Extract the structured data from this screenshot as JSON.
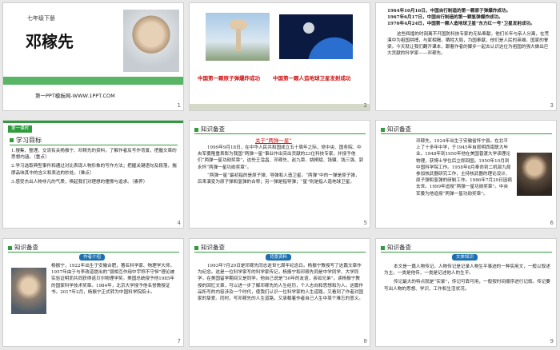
{
  "slides": [
    {
      "num": "1",
      "grade": "七年级下册",
      "title": "邓稼先",
      "footer": "第一PPT模板网-WWW.1PPT.COM"
    },
    {
      "num": "2",
      "caption1": "中国第一颗原子弹爆炸成功",
      "caption2": "中国第一颗人造地球卫星发射成功"
    },
    {
      "num": "3",
      "lines_red": [
        "1964年10月16日，中国自行制造的第一颗原子弹爆炸成功。",
        "1967年6月17日，中国自行制造的第一颗氢弹爆炸成功。",
        "1970年4月24日，中国第一颗人造地球卫星“东方红一号”卫星发射成功。"
      ],
      "para": "这些辉煌的时刻离不开国防科技专家的无私奉献。他们长年与亲人分离，在荒漠中为祖国拼搏，与家相隔，牺牲大局，为国奉献，他们是人民的英雄，国家的脊梁。今天就让我们翻开课本，跟着作者的脚步一起去认识这位为祖国的强大做出巨大贡献的科学家——邓稼先。"
    },
    {
      "num": "4",
      "tab": "第一课时",
      "section": "学习目标",
      "items": [
        "1.搜集、整理、交流有关杨振宁、邓稼先的资料，了解作者及写作背景，把握文章的思想内涵。（重点）",
        "2.学习选取典型事件和通过对比表现人物形象的写作方法；把握关键语句及段落，揣摩品味其中的含义和表达的妙处。（难点）",
        "3.感受杰出人物非凡的气质，唤起我们对理想的憧憬与追求。（素养）"
      ]
    },
    {
      "num": "5",
      "section": "知识备查",
      "title": "关于“两弹一星”",
      "para": "1999年9月18日，在中华人民共和国成立五十周年之际，党中央、国务院、中央军委隆重表彰为我国“两弹一星”事业作出突出贡献的23位科技专家，并授予他们“两弹一星功勋奖章”，这些王淦昌、邓稼先、赵九章、姚桐斌、钱骥、钱三强、郭永怀“两弹一星功勋奖章”。",
      "note": "“两弹一星”最初指的是原子弹、导弹和人造卫星。“两弹”中的一弹是原子弹，后来演变为原子弹和氢弹的合称；另一弹是指导弹；“星”则是指人造地球卫星。"
    },
    {
      "num": "6",
      "section": "知识备查",
      "para": "邓稼先，1924年出生于安徽省怀宁县。在北平上了十多年中学，于1945年自昆明西南联大毕业。1948年到1950年他在美国普渡大学读理论物理，获博士学位后立即回国。1950年10月到中国科学院工作。1958年8月奉命到二机部九局参加核武器研究工作，主持核武器的理论设计、原子弹和氢弹的研制工作。1986年7月29日因病去世。1999年追授“两弹一星功勋奖章”。中央军委为他追授“两弹一星功勋奖章”。"
    },
    {
      "num": "7",
      "section": "知识备查",
      "label": "作者介绍",
      "para": "杨振宁，1922年出生于安徽合肥，著名科学家、物理学大师。1957年由于与李政道提出的“弱相互作用中宇称不守恒”理论被实验证明而共同获得诺贝尔物理学奖。美国总统授予他1985年的国家科学技术奖章。1984年，北京大学授予他名誉教授证书。2017年2月，杨振宁正式转为中国科学院院士。"
    },
    {
      "num": "8",
      "section": "知识备查",
      "label": "背景资料",
      "para": "1993年7月29日是邓稼先同志逝世七周年纪念日。杨振宁教授写了这篇文章作为纪念。这是一位科学家写的科学家传记，杨振宁和邓稼先同是中学同学、大学同学，在美国留学期间又是同学。他自己说是“50年的友谊，亲如兄弟”。读杨振宁教授的回忆文章，可以进一步了解邓稼先的人生经历，个人志向和思想和为人。这篇作品所写的内容涉及一个时代，使我们认识一位科学家的人生道路，又看到了作者对国家的挚爱。同时，写邓稼先的人生道路，又承载着作者自己人生中某个难忘的意义。"
    },
    {
      "num": "9",
      "section": "知识备查",
      "label": "文体知识",
      "para1": "本文是一篇人物传记。人物传记是记录人物生平事迹的一种实用文，一般以叙述为主。一类是他传，一类是记述他人的生平。",
      "para2": "传记最大的特点就是“实录”，传记可靠可用，一般按时间顺序进行记叙。传记要写出人物的思想、学识、工作和生活状况。"
    }
  ]
}
